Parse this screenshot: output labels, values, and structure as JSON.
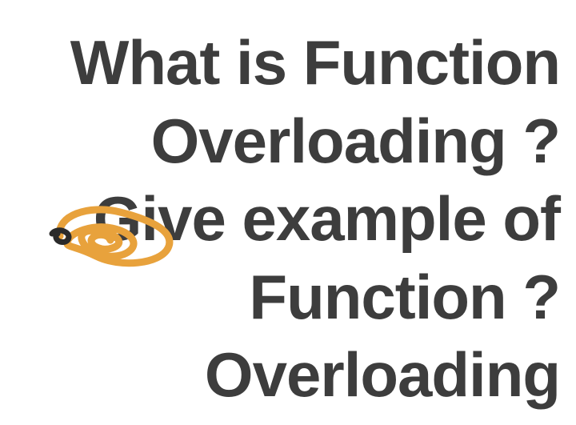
{
  "question": {
    "text": "What is Function Overloading ? Give example of Function ?Overloading"
  },
  "annotation": {
    "type": "scribble",
    "color": "#E8A23C"
  }
}
